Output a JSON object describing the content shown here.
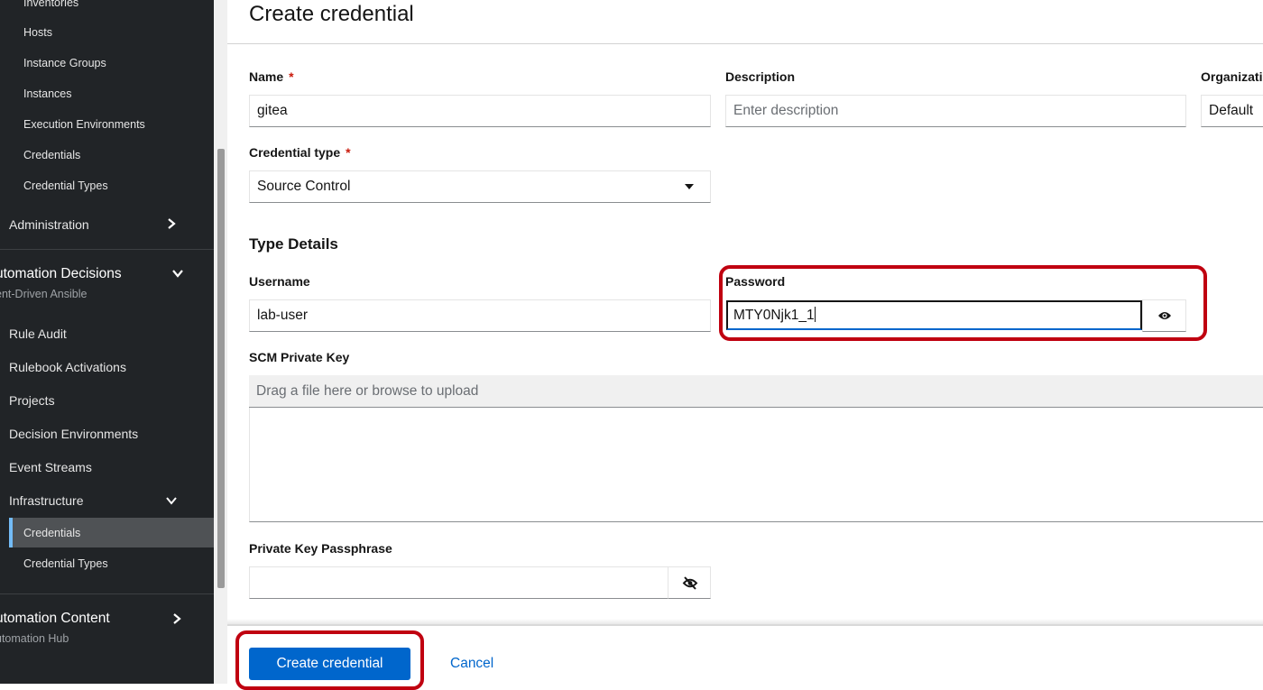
{
  "sidebar": {
    "top_items": [
      {
        "label": "Inventories"
      },
      {
        "label": "Hosts"
      },
      {
        "label": "Instance Groups"
      },
      {
        "label": "Instances"
      },
      {
        "label": "Execution Environments"
      },
      {
        "label": "Credentials"
      },
      {
        "label": "Credential Types"
      }
    ],
    "administration": {
      "label": "Administration"
    },
    "decisions": {
      "title": "utomation Decisions",
      "subtitle": "ent-Driven Ansible",
      "items": [
        {
          "label": "Rule Audit"
        },
        {
          "label": "Rulebook Activations"
        },
        {
          "label": "Projects"
        },
        {
          "label": "Decision Environments"
        },
        {
          "label": "Event Streams"
        },
        {
          "label": "Infrastructure"
        }
      ],
      "infrastructure_items": [
        {
          "label": "Credentials"
        },
        {
          "label": "Credential Types"
        }
      ]
    },
    "content": {
      "title": "utomation Content",
      "subtitle": "utomation Hub"
    }
  },
  "page": {
    "title": "Create credential"
  },
  "form": {
    "name": {
      "label": "Name",
      "required": "*",
      "value": "gitea"
    },
    "description": {
      "label": "Description",
      "placeholder": "Enter description"
    },
    "organization": {
      "label": "Organizati",
      "value": "Default"
    },
    "credential_type": {
      "label": "Credential type",
      "required": "*",
      "value": "Source Control"
    },
    "type_details": {
      "title": "Type Details"
    },
    "username": {
      "label": "Username",
      "value": "lab-user"
    },
    "password": {
      "label": "Password",
      "value": "MTY0Njk1_1"
    },
    "scm_key": {
      "label": "SCM Private Key",
      "placeholder": "Drag a file here or browse to upload"
    },
    "passphrase": {
      "label": "Private Key Passphrase",
      "value": ""
    }
  },
  "actions": {
    "create": "Create credential",
    "cancel": "Cancel"
  },
  "icons": {
    "password_toggle": "eye-icon",
    "passphrase_toggle": "eye-slash-icon",
    "chevron_right": "chevron-right-icon",
    "chevron_down": "chevron-down-icon"
  },
  "colors": {
    "primary": "#0066cc",
    "highlight": "#c00010",
    "sidebar": "#212427"
  }
}
